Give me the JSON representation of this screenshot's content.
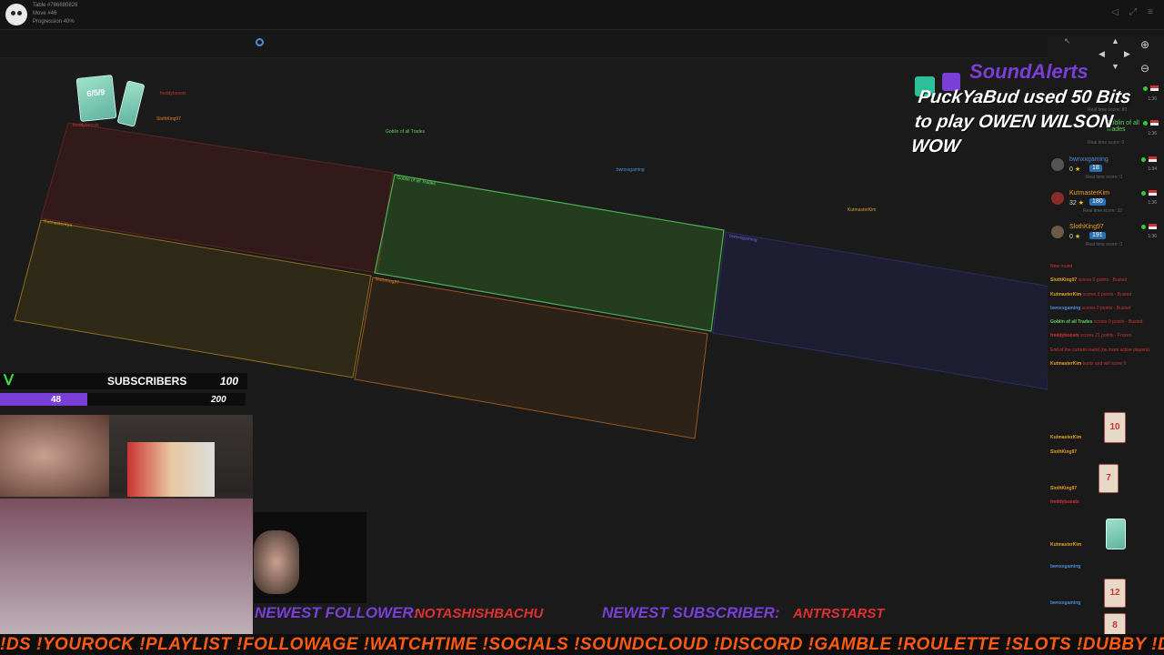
{
  "header": {
    "table": "Table #786680826",
    "move": "Move #46",
    "progression": "Progression 40%",
    "icons": [
      "speaker-muted-icon",
      "fullscreen-icon",
      "menu-icon"
    ]
  },
  "board": {
    "zones": [
      {
        "label": "freddyboosts",
        "color": "#c0392b"
      },
      {
        "label": "Goblin of all Trades",
        "color": "#4caf50"
      },
      {
        "label": "bwnxxgaming",
        "color": "#3b3ba8"
      },
      {
        "label": "KutmasterKim",
        "color": "#d4a020"
      },
      {
        "label": "SlothKing97",
        "color": "#e67e22"
      }
    ],
    "hand_labels": [
      "freddyboosts",
      "SlothKing97",
      "Goblin of all Trades",
      "bwnxxgaming",
      "KutmasterKim"
    ],
    "zero": "0",
    "card_top": "6/5/9"
  },
  "alert": {
    "title": "SoundAlerts",
    "message": "PuckYaBud used 50 Bits to play OWEN WILSON WOW"
  },
  "players": [
    {
      "name": "Goblin of all Trades",
      "time": "1:36",
      "real": "Real time score: 0",
      "color": "#5dd35d"
    },
    {
      "name": "bwnxxgaming",
      "score": "0",
      "chip": "18",
      "time": "1:34",
      "real": "Real time score: 0",
      "color": "#4a8fd8"
    },
    {
      "name": "KutmasterKim",
      "score": "32",
      "chip": "180",
      "time": "1:36",
      "real": "Real time score: 32",
      "color": "#e8a020"
    },
    {
      "name": "SlothKing97",
      "score": "0",
      "chip": "191",
      "time": "1:36",
      "real": "Real time score: 0",
      "color": "#e8a020"
    }
  ],
  "top_entries": [
    {
      "time": "1:36",
      "real": "Real time score: 80"
    },
    {
      "time": "1:36",
      "real": "Real time score: 0"
    }
  ],
  "log": [
    {
      "name": "New round",
      "text": "",
      "color": "#d33"
    },
    {
      "name": "SlothKing97",
      "text": "scores 0 points - Busted",
      "color": "#e8a020"
    },
    {
      "name": "KutmasterKim",
      "text": "scores 0 points - Busted",
      "color": "#e8a020"
    },
    {
      "name": "bwnxxgaming",
      "text": "scores 0 points - Busted",
      "color": "#4a8fd8"
    },
    {
      "name": "Goblin of all Trades",
      "text": "scores 0 points - Busted",
      "color": "#5dd35d"
    },
    {
      "name": "freddyboosts",
      "text": "scores 21 points - Frozen",
      "color": "#d33"
    },
    {
      "name": "End of the current round (no more active players)",
      "text": "",
      "color": "#d33"
    },
    {
      "name": "KutmasterKim",
      "text": "busts and will score 0",
      "color": "#e8a020"
    }
  ],
  "deal_log": [
    {
      "name": "KutmasterKim",
      "text": "gets",
      "card": "10",
      "color": "#e8a020"
    },
    {
      "name": "SlothKing97",
      "text": "gets",
      "card": "7",
      "color": "#e8a020"
    },
    {
      "name": "freddyboosts",
      "text": "gets",
      "card": "",
      "color": "#d33"
    },
    {
      "name": "KutmasterKim",
      "text": "gets",
      "card": "",
      "color": "#e8a020"
    },
    {
      "name": "bwnxxgaming",
      "text": "gets",
      "card": "12",
      "color": "#4a8fd8"
    },
    {
      "name": "bwnxxgaming",
      "text": "gets",
      "card": "8",
      "color": "#4a8fd8"
    }
  ],
  "subgoal": {
    "label": "SUBSCRIBERS",
    "target": "100",
    "current": "48",
    "bar_target": "200",
    "progress": 0.24
  },
  "overlay": {
    "follower_label": "NEWEST FOLLOWER:",
    "follower": "NOTASHISHBACHU",
    "subscriber_label": "NEWEST SUBSCRIBER:",
    "subscriber": "ANTRSTARST"
  },
  "ticker": "!DS !YOUROCK !PLAYLIST !FOLLOWAGE !WATCHTIME !SOCIALS !SOUNDCLOUD !DISCORD !GAMBLE !ROULETTE !SLOTS !DUBBY !DOBIE"
}
